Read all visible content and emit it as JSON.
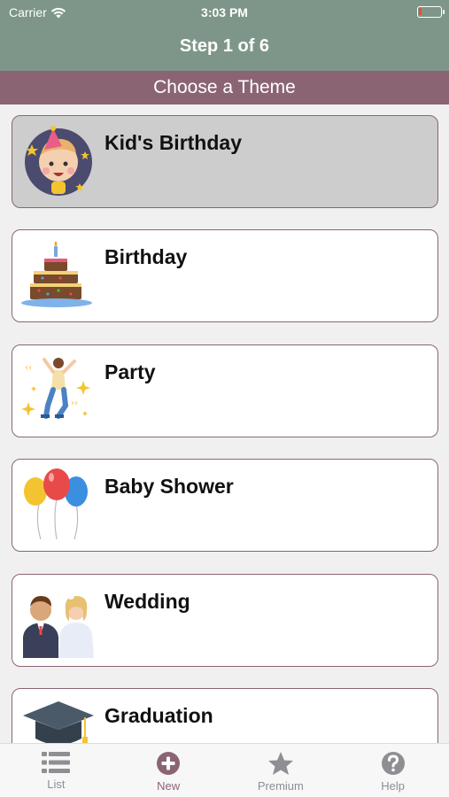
{
  "status_bar": {
    "carrier": "Carrier",
    "time": "3:03 PM"
  },
  "nav": {
    "title": "Step 1 of 6"
  },
  "subheader": {
    "title": "Choose a Theme"
  },
  "themes": [
    {
      "label": "Kid's Birthday",
      "icon": "kid-face-icon",
      "selected": true
    },
    {
      "label": "Birthday",
      "icon": "birthday-cake-icon",
      "selected": false
    },
    {
      "label": "Party",
      "icon": "dancing-person-icon",
      "selected": false
    },
    {
      "label": "Baby Shower",
      "icon": "balloons-icon",
      "selected": false
    },
    {
      "label": "Wedding",
      "icon": "couple-icon",
      "selected": false
    },
    {
      "label": "Graduation",
      "icon": "graduation-cap-icon",
      "selected": false
    }
  ],
  "tabbar": {
    "items": [
      {
        "label": "List",
        "icon": "list-icon",
        "active": false
      },
      {
        "label": "New",
        "icon": "plus-circle-icon",
        "active": true
      },
      {
        "label": "Premium",
        "icon": "star-icon",
        "active": false
      },
      {
        "label": "Help",
        "icon": "question-circle-icon",
        "active": false
      }
    ]
  },
  "colors": {
    "nav_background": "#7e9689",
    "accent": "#8b6474",
    "selected_card": "#cdcdcd"
  }
}
